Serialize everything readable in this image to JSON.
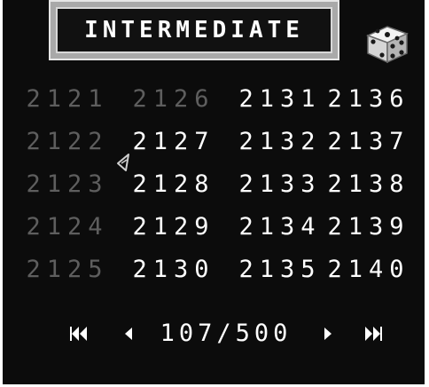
{
  "difficulty": {
    "title": "INTERMEDIATE"
  },
  "random_button": {
    "icon": "dice-icon"
  },
  "puzzles": {
    "columns": [
      [
        {
          "label": "2121",
          "locked": true
        },
        {
          "label": "2122",
          "locked": true
        },
        {
          "label": "2123",
          "locked": true
        },
        {
          "label": "2124",
          "locked": true
        },
        {
          "label": "2125",
          "locked": true
        }
      ],
      [
        {
          "label": "2126",
          "locked": true
        },
        {
          "label": "2127",
          "locked": false
        },
        {
          "label": "2128",
          "locked": false
        },
        {
          "label": "2129",
          "locked": false
        },
        {
          "label": "2130",
          "locked": false
        }
      ],
      [
        {
          "label": "2131",
          "locked": false
        },
        {
          "label": "2132",
          "locked": false
        },
        {
          "label": "2133",
          "locked": false
        },
        {
          "label": "2134",
          "locked": false
        },
        {
          "label": "2135",
          "locked": false
        }
      ],
      [
        {
          "label": "2136",
          "locked": false
        },
        {
          "label": "2137",
          "locked": false
        },
        {
          "label": "2138",
          "locked": false
        },
        {
          "label": "2139",
          "locked": false
        },
        {
          "label": "2140",
          "locked": false
        }
      ]
    ]
  },
  "pagination": {
    "page_label": "107/500",
    "first_icon": "double-left-arrow-icon",
    "prev_icon": "left-arrow-icon",
    "next_icon": "right-arrow-icon",
    "last_icon": "double-right-arrow-icon"
  },
  "colors": {
    "background": "#0c0c0c",
    "unlocked_text": "#ffffff",
    "locked_text": "#5e5e5e"
  },
  "cursor": {
    "icon": "pointer-cursor-icon"
  }
}
